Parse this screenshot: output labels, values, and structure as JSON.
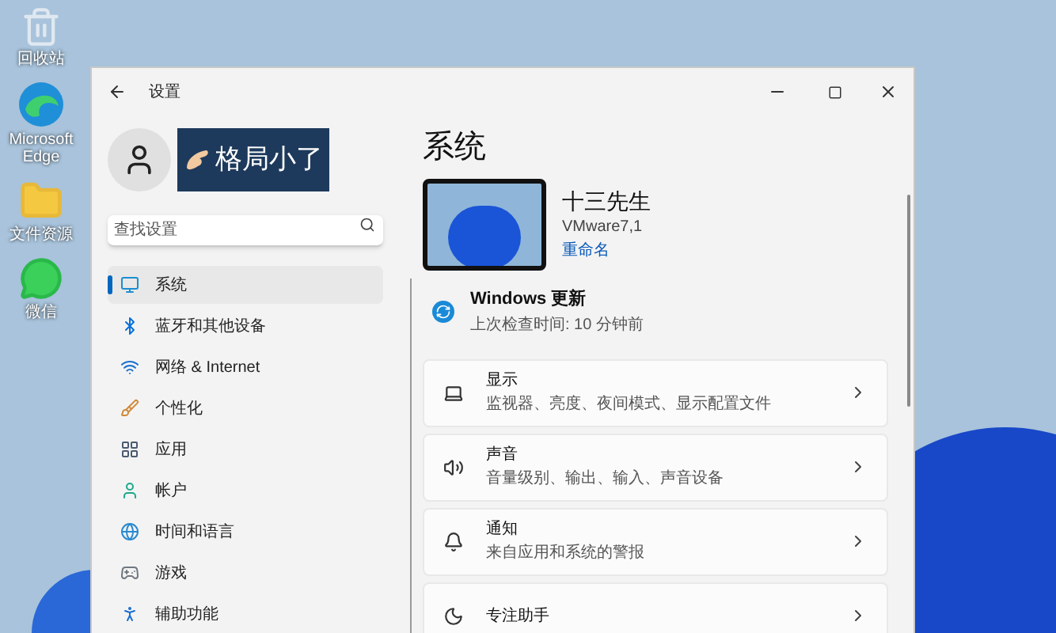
{
  "desktop_icons": [
    {
      "kind": "recycle",
      "label": "回收站"
    },
    {
      "kind": "edge",
      "label": "Microsoft Edge"
    },
    {
      "kind": "folder",
      "label": "文件资源"
    },
    {
      "kind": "chat",
      "label": "微信"
    }
  ],
  "window": {
    "title": "设置"
  },
  "account": {
    "name": "格局小了"
  },
  "search": {
    "placeholder": "查找设置"
  },
  "nav": [
    {
      "kind": "system",
      "label": "系统",
      "selected": true
    },
    {
      "kind": "bluetooth",
      "label": "蓝牙和其他设备",
      "selected": false
    },
    {
      "kind": "network",
      "label": "网络 & Internet",
      "selected": false
    },
    {
      "kind": "brush",
      "label": "个性化",
      "selected": false
    },
    {
      "kind": "apps",
      "label": "应用",
      "selected": false
    },
    {
      "kind": "account",
      "label": "帐户",
      "selected": false
    },
    {
      "kind": "time",
      "label": "时间和语言",
      "selected": false
    },
    {
      "kind": "game",
      "label": "游戏",
      "selected": false
    },
    {
      "kind": "access",
      "label": "辅助功能",
      "selected": false
    }
  ],
  "page": {
    "title": "系统",
    "device": {
      "name": "十三先生",
      "model": "VMware7,1",
      "rename": "重命名"
    },
    "update": {
      "title": "Windows 更新",
      "subtitle": "上次检查时间: 10 分钟前"
    },
    "cards": [
      {
        "kind": "display",
        "title": "显示",
        "subtitle": "监视器、亮度、夜间模式、显示配置文件"
      },
      {
        "kind": "sound",
        "title": "声音",
        "subtitle": "音量级别、输出、输入、声音设备"
      },
      {
        "kind": "bell",
        "title": "通知",
        "subtitle": "来自应用和系统的警报"
      },
      {
        "kind": "focus",
        "title": "专注助手"
      }
    ]
  }
}
